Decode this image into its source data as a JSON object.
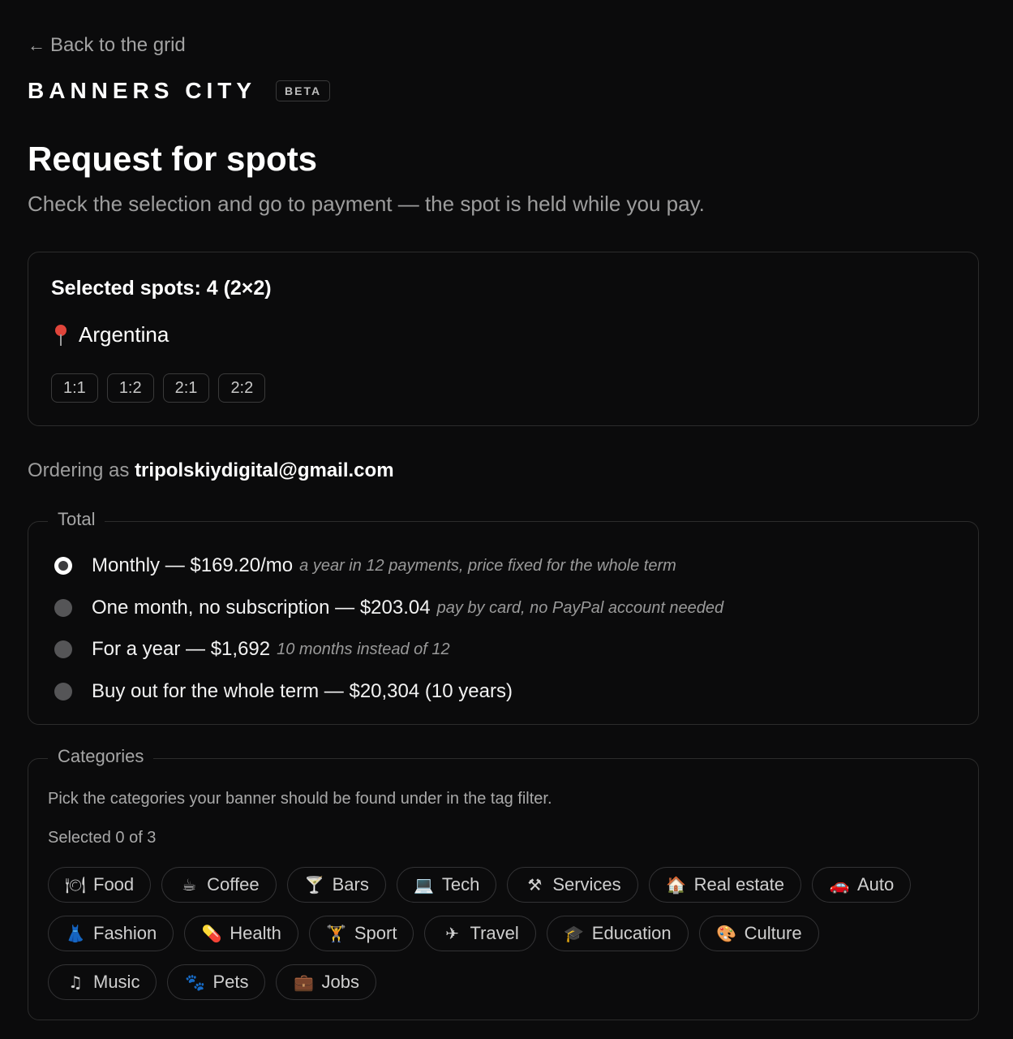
{
  "nav": {
    "back_arrow": "←",
    "back_label": "Back to the grid"
  },
  "brand": {
    "name": "BANNERS CITY",
    "badge": "BETA"
  },
  "header": {
    "title": "Request for spots",
    "subtitle": "Check the selection and go to payment — the spot is held while you pay."
  },
  "selection": {
    "title": "Selected spots: 4 (2×2)",
    "location": "Argentina",
    "spots": [
      "1:1",
      "1:2",
      "2:1",
      "2:2"
    ]
  },
  "ordering": {
    "prefix": "Ordering as",
    "email": "tripolskiydigital@gmail.com"
  },
  "total": {
    "legend": "Total",
    "options": [
      {
        "label": "Monthly — $169.20/mo",
        "note": "a year in 12 payments, price fixed for the whole term",
        "selected": true
      },
      {
        "label": "One month, no subscription — $203.04",
        "note": "pay by card, no PayPal account needed",
        "selected": false
      },
      {
        "label": "For a year — $1,692",
        "note": "10 months instead of 12",
        "selected": false
      },
      {
        "label": "Buy out for the whole term — $20,304 (10 years)",
        "note": "",
        "selected": false
      }
    ]
  },
  "categories": {
    "legend": "Categories",
    "description": "Pick the categories your banner should be found under in the tag filter.",
    "count": "Selected 0 of 3",
    "items": [
      {
        "label": "Food",
        "icon": "plate-icon",
        "glyph": "🍽"
      },
      {
        "label": "Coffee",
        "icon": "coffee-icon",
        "glyph": "☕"
      },
      {
        "label": "Bars",
        "icon": "cocktail-icon",
        "glyph": "🍸"
      },
      {
        "label": "Tech",
        "icon": "laptop-icon",
        "glyph": "💻"
      },
      {
        "label": "Services",
        "icon": "tools-icon",
        "glyph": "⚒"
      },
      {
        "label": "Real estate",
        "icon": "house-icon",
        "glyph": "🏠"
      },
      {
        "label": "Auto",
        "icon": "car-icon",
        "glyph": "🚗"
      },
      {
        "label": "Fashion",
        "icon": "dress-icon",
        "glyph": "👗"
      },
      {
        "label": "Health",
        "icon": "pill-icon",
        "glyph": "💊"
      },
      {
        "label": "Sport",
        "icon": "weightlifter-icon",
        "glyph": "🏋"
      },
      {
        "label": "Travel",
        "icon": "airplane-icon",
        "glyph": "✈"
      },
      {
        "label": "Education",
        "icon": "graduation-cap-icon",
        "glyph": "🎓"
      },
      {
        "label": "Culture",
        "icon": "palette-icon",
        "glyph": "🎨"
      },
      {
        "label": "Music",
        "icon": "music-note-icon",
        "glyph": "♫"
      },
      {
        "label": "Pets",
        "icon": "paw-icon",
        "glyph": "🐾"
      },
      {
        "label": "Jobs",
        "icon": "briefcase-icon",
        "glyph": "💼"
      }
    ]
  },
  "colors": {
    "background": "#0b0b0c",
    "border": "#2c2c2c",
    "muted_text": "#9d9d9d",
    "radio_selected": "#ffffff",
    "radio_unselected": "#555557",
    "pin": "#e0453b"
  }
}
